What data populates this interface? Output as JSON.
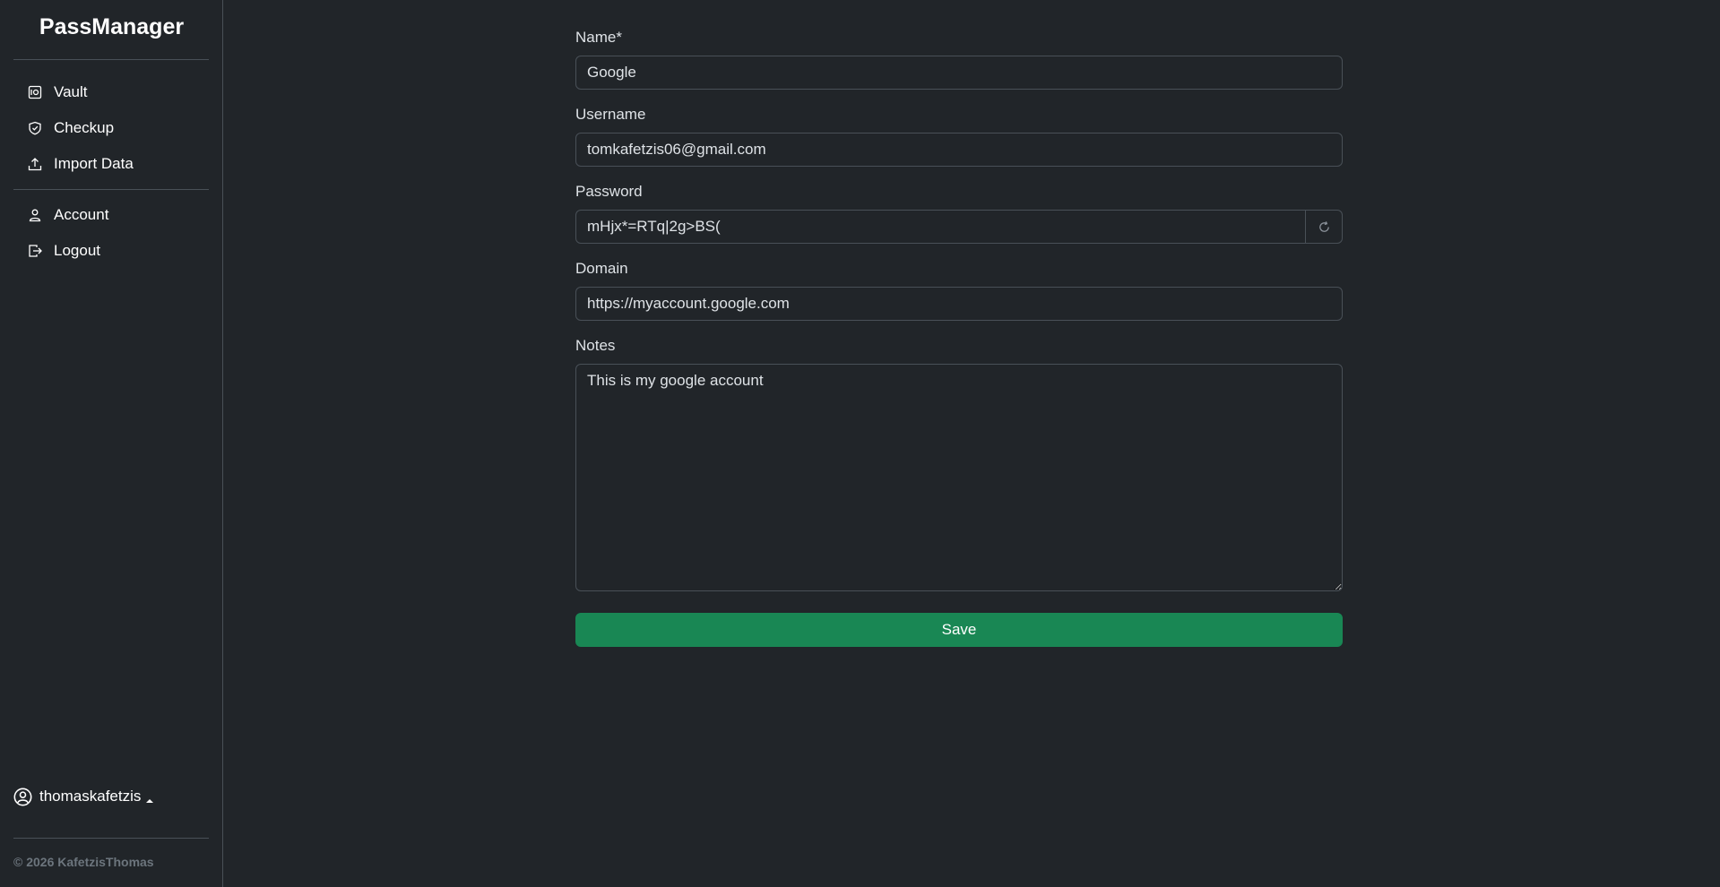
{
  "sidebar": {
    "brand": "PassManager",
    "nav": [
      {
        "label": "Vault",
        "icon": "vault-icon"
      },
      {
        "label": "Checkup",
        "icon": "shield-check-icon"
      },
      {
        "label": "Import Data",
        "icon": "upload-icon"
      }
    ],
    "account_nav": [
      {
        "label": "Account",
        "icon": "person-icon"
      },
      {
        "label": "Logout",
        "icon": "logout-icon"
      }
    ],
    "user": {
      "name": "thomaskafetzis",
      "icon": "user-circle-icon"
    },
    "footer": "© 2026 KafetzisThomas"
  },
  "form": {
    "name": {
      "label": "Name*",
      "value": "Google"
    },
    "username": {
      "label": "Username",
      "value": "tomkafetzis06@gmail.com"
    },
    "password": {
      "label": "Password",
      "value": "mHjx*=RTq|2g>BS(",
      "regen_icon": "refresh-icon"
    },
    "domain": {
      "label": "Domain",
      "value": "https://myaccount.google.com"
    },
    "notes": {
      "label": "Notes",
      "value": "This is my google account"
    },
    "save_label": "Save"
  },
  "colors": {
    "background": "#212529",
    "border": "#495057",
    "accent_green": "#198754",
    "footer_text": "#6c757d"
  }
}
